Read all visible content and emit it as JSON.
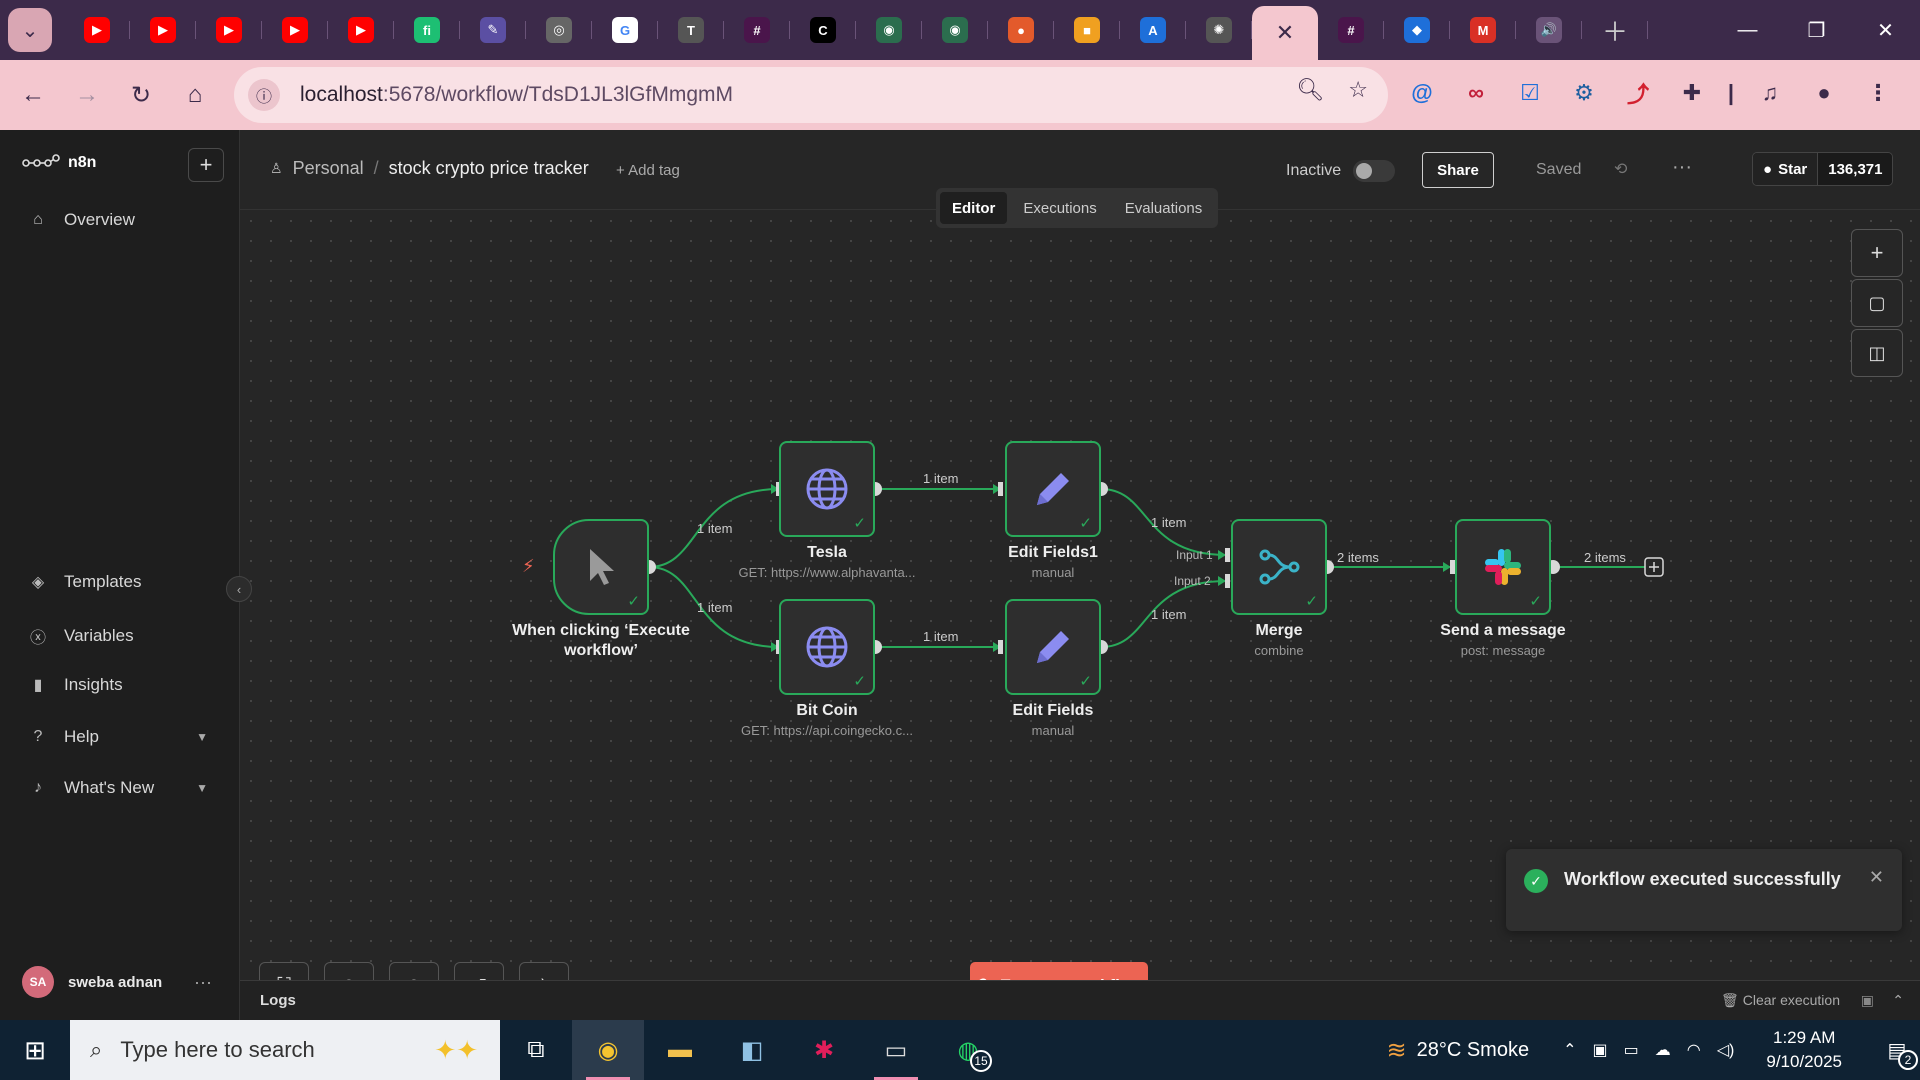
{
  "browser": {
    "tabs": [
      {
        "icon": "youtube-icon",
        "color": "#ff0000",
        "glyph": "▶"
      },
      {
        "icon": "youtube-icon",
        "color": "#ff0000",
        "glyph": "▶"
      },
      {
        "icon": "youtube-icon",
        "color": "#ff0000",
        "glyph": "▶"
      },
      {
        "icon": "youtube-icon",
        "color": "#ff0000",
        "glyph": "▶"
      },
      {
        "icon": "youtube-icon",
        "color": "#ff0000",
        "glyph": "▶"
      },
      {
        "icon": "fiverr-icon",
        "color": "#1dbf73",
        "glyph": "fi"
      },
      {
        "icon": "app-icon",
        "color": "#5b4fa3",
        "glyph": "✎"
      },
      {
        "icon": "toyota-icon",
        "color": "#666666",
        "glyph": "◎"
      },
      {
        "icon": "google-icon",
        "color": "#ffffff",
        "glyph": "G"
      },
      {
        "icon": "toyota-icon",
        "color": "#555555",
        "glyph": "T"
      },
      {
        "icon": "slack-icon",
        "color": "#4a154b",
        "glyph": "#"
      },
      {
        "icon": "c-icon",
        "color": "#000000",
        "glyph": "C"
      },
      {
        "icon": "chatgpt-icon",
        "color": "#2b6d4e",
        "glyph": "◉"
      },
      {
        "icon": "chatgpt-icon",
        "color": "#2b6d4e",
        "glyph": "◉"
      },
      {
        "icon": "app-icon",
        "color": "#e35a2b",
        "glyph": "●"
      },
      {
        "icon": "app-icon",
        "color": "#f0a020",
        "glyph": "■"
      },
      {
        "icon": "app-icon",
        "color": "#1e6fd9",
        "glyph": "A"
      },
      {
        "icon": "openai-icon",
        "color": "#555555",
        "glyph": "✺"
      }
    ],
    "tabs_after": [
      {
        "icon": "slack-icon",
        "color": "#4a154b",
        "glyph": "#"
      },
      {
        "icon": "app-icon",
        "color": "#1e6fd9",
        "glyph": "◆"
      },
      {
        "icon": "gmail-icon",
        "color": "#d93025",
        "glyph": "M"
      },
      {
        "icon": "speaker-icon",
        "color": "#6a5378",
        "glyph": "🔊"
      }
    ],
    "url_host": "localhost",
    "url_path": ":5678/workflow/TdsD1JL3lGfMmgmM"
  },
  "sidebar": {
    "brand": "n8n",
    "items_top": [
      {
        "label": "Overview",
        "icon": "home-icon",
        "glyph": "⌂"
      }
    ],
    "items_bottom": [
      {
        "label": "Templates",
        "icon": "templates-icon",
        "glyph": "◈"
      },
      {
        "label": "Variables",
        "icon": "variables-icon",
        "glyph": "ⓧ"
      },
      {
        "label": "Insights",
        "icon": "insights-icon",
        "glyph": "▮"
      },
      {
        "label": "Help",
        "icon": "help-icon",
        "glyph": "?"
      },
      {
        "label": "What's New",
        "icon": "bell-icon",
        "glyph": "🔔"
      }
    ],
    "user_initials": "SA",
    "user_name": "sweba adnan"
  },
  "header": {
    "project": "Personal",
    "workflow_name": "stock crypto price tracker",
    "add_tag": "+ Add tag",
    "active_state": "Inactive",
    "share_label": "Share",
    "saved_label": "Saved",
    "github_star": "Star",
    "github_count": "136,371"
  },
  "view_tabs": [
    "Editor",
    "Executions",
    "Evaluations"
  ],
  "workflow": {
    "nodes": {
      "trigger": {
        "label": "When clicking ‘Execute workflow’",
        "icon": "cursor-icon"
      },
      "tesla": {
        "label": "Tesla",
        "sub": "GET: https://www.alphavanta...",
        "icon": "globe-icon"
      },
      "bitcoin": {
        "label": "Bit Coin",
        "sub": "GET: https://api.coingecko.c...",
        "icon": "globe-icon"
      },
      "edit1": {
        "label": "Edit Fields1",
        "sub": "manual",
        "icon": "pencil-icon"
      },
      "edit": {
        "label": "Edit Fields",
        "sub": "manual",
        "icon": "pencil-icon"
      },
      "merge": {
        "label": "Merge",
        "sub": "combine",
        "icon": "merge-icon"
      },
      "slack": {
        "label": "Send a message",
        "sub": "post: message",
        "icon": "slack-icon"
      }
    },
    "edges": {
      "trigger_tesla": "1 item",
      "trigger_bitcoin": "1 item",
      "tesla_edit1": "1 item",
      "bitcoin_edit": "1 item",
      "edit1_merge": "1 item",
      "edit_merge": "1 item",
      "merge_slack": "2 items",
      "slack_out": "2 items",
      "merge_input1": "Input 1",
      "merge_input2": "Input 2"
    }
  },
  "execute_label": "Execute workflow",
  "toast": {
    "message": "Workflow executed successfully"
  },
  "logs": {
    "title": "Logs",
    "clear": "Clear execution"
  },
  "taskbar": {
    "search_placeholder": "Type here to search",
    "weather": "28°C  Smoke",
    "time": "1:29 AM",
    "date": "9/10/2025",
    "whatsapp_badge": "15",
    "notif_count": "2"
  },
  "colors": {
    "accent": "#ec6453",
    "success": "#29a95a"
  }
}
